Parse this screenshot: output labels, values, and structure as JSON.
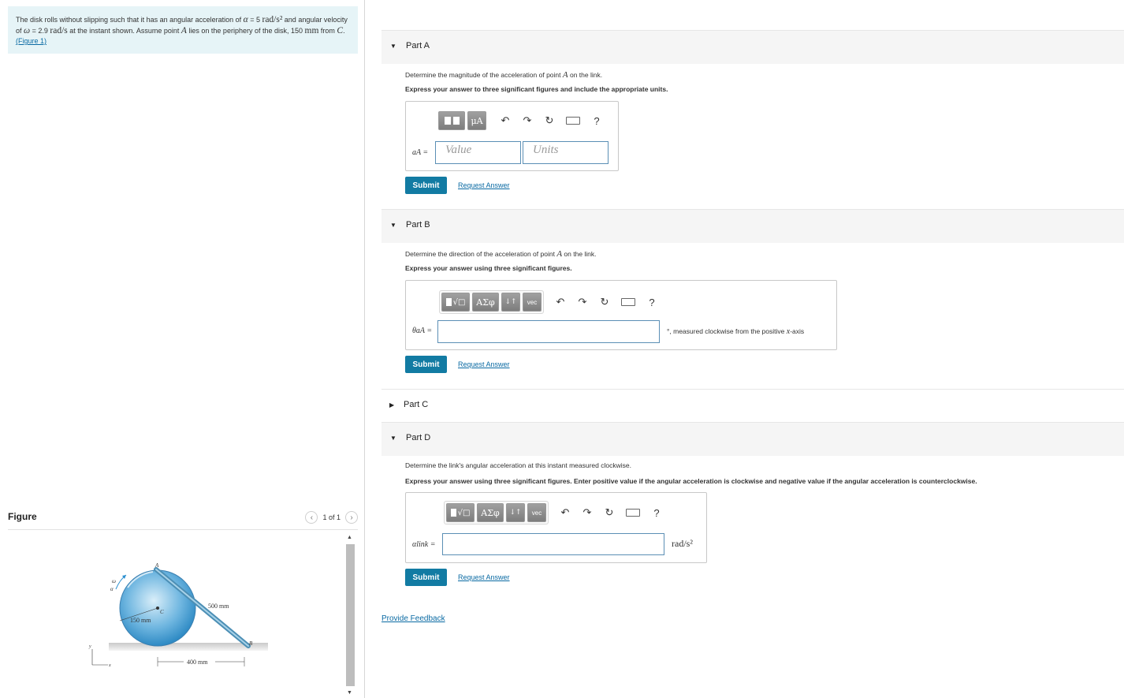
{
  "problem": {
    "text_1": "The disk rolls without slipping such that it has an angular acceleration of ",
    "alpha_sym": "α",
    "alpha_eq": " = 5 ",
    "alpha_unit": "rad/s²",
    "text_2": " and angular velocity of ",
    "omega_sym": "ω",
    "omega_eq": " = 2.9 ",
    "omega_unit": "rad/s",
    "text_3": " at the instant shown. Assume point ",
    "point": "A",
    "text_4": " lies on the periphery of the disk, 150 ",
    "mm": "mm",
    "text_5": " from ",
    "center": "C",
    "text_6": ". ",
    "figure_link": "(Figure 1)"
  },
  "figure": {
    "heading": "Figure",
    "pager": "1 of 1",
    "prev": "‹",
    "next": "›",
    "labels": {
      "omega": "ω",
      "alpha": "α",
      "A": "A",
      "C": "C",
      "B": "B",
      "y": "y",
      "x": "x",
      "link_len": "500 mm",
      "radius": "150 mm",
      "base": "400 mm"
    }
  },
  "parts": {
    "a": {
      "title": "Part A",
      "question_1": "Determine the magnitude of the acceleration of point ",
      "question_point": "A",
      "question_2": " on the link.",
      "instruction": "Express your answer to three significant figures and include the appropriate units.",
      "toolbar_unit_btn": "μA",
      "label": "aA =",
      "value_placeholder": "Value",
      "units_placeholder": "Units",
      "help": "?"
    },
    "b": {
      "title": "Part B",
      "question_1": "Determine the direction of the acceleration of point ",
      "question_point": "A",
      "question_2": " on the link.",
      "instruction": "Express your answer using three significant figures.",
      "sym_btn": "ΑΣφ",
      "arrows_btn": "↓↑",
      "vec_btn": "vec",
      "label": "θaA =",
      "unit_note_1": "°, measured clockwise from the positive ",
      "unit_note_x": "x",
      "unit_note_2": "-axis",
      "help": "?"
    },
    "c": {
      "title": "Part C"
    },
    "d": {
      "title": "Part D",
      "question": "Determine the link's angular acceleration at this instant measured clockwise.",
      "instruction": "Express your answer using three significant figures. Enter positive value if the angular acceleration is clockwise and negative value if the angular acceleration is counterclockwise.",
      "sym_btn": "ΑΣφ",
      "arrows_btn": "↓↑",
      "vec_btn": "vec",
      "label": "αlink =",
      "unit": "rad/s²",
      "help": "?"
    }
  },
  "buttons": {
    "submit": "Submit",
    "request_answer": "Request Answer"
  },
  "feedback": "Provide Feedback"
}
